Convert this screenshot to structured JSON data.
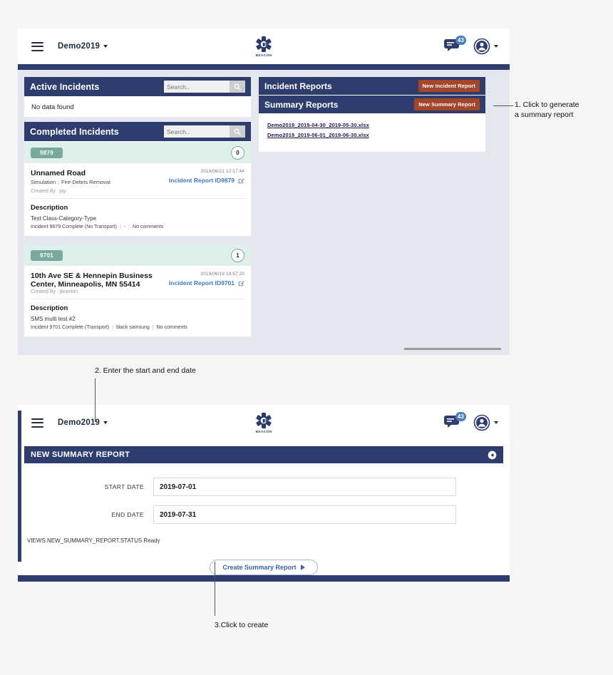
{
  "appbar": {
    "menu_icon": "hamburger-icon",
    "org_name": "Demo2019",
    "brand_word": "BEACON",
    "chat_badge": "43",
    "chat_icon": "chat-bubble-icon",
    "avatar_icon": "user-avatar-icon"
  },
  "active_incidents": {
    "title": "Active Incidents",
    "search_placeholder": "Search..",
    "search_value": "",
    "empty_text": "No data found"
  },
  "completed_incidents": {
    "title": "Completed Incidents",
    "search_placeholder": "Search..",
    "search_value": "",
    "cards": [
      {
        "id_chip": "9879",
        "count": "0",
        "title": "Unnamed Road",
        "sub_left": "Simulation",
        "sub_right": "Fire-Debris Removal",
        "timestamp": "2019/06/21 12:17:44",
        "report_link": "Incident Report ID9879",
        "created_by": "Created By : jay",
        "description_heading": "Description",
        "description_line": "Test Class-Category-Type",
        "meta_status": "Incident 9879 Complete (No Transport)",
        "meta_middle": "-",
        "meta_comments": "No comments"
      },
      {
        "id_chip": "9701",
        "count": "1",
        "title": "10th Ave SE & Hennepin Business Center, Minneapolis, MN 55414",
        "sub_left": "",
        "sub_right": "",
        "timestamp": "2019/06/19 10:57:20",
        "report_link": "Incident Report ID9701",
        "created_by": "Created By : jbranton",
        "description_heading": "Description",
        "description_line": "SMS multi test #2",
        "meta_status": "Incident 9701 Complete (Transport)",
        "meta_middle": "black samsung",
        "meta_comments": "No comments"
      }
    ]
  },
  "incident_reports": {
    "title": "Incident Reports",
    "button_label": "New Incident Report"
  },
  "summary_reports": {
    "title": "Summary Reports",
    "button_label": "New Summary Report",
    "files": [
      "Demo2019_2019-04-30_2019-05-30.xlsx",
      "Demo2019_2019-06-01_2019-06-30.xlsx"
    ]
  },
  "new_summary_report": {
    "title": "NEW SUMMARY REPORT",
    "back_icon": "back-arrow-icon",
    "start_date_label": "START DATE",
    "start_date_value": "2019-07-01",
    "end_date_label": "END DATE",
    "end_date_value": "2019-07-31",
    "status_text": "VIEWS.NEW_SUMMARY_REPORT.STATUS Ready",
    "create_button": "Create Summary Report"
  },
  "annotations": [
    "1. Click to generate\na summary report",
    "2. Enter the start and end date",
    "3.Click to create"
  ],
  "annotation_texts": {
    "one_line1": "1. Click to generate",
    "one_line2": "a summary report",
    "two": "2. Enter the start and end date",
    "three": "3.Click to create"
  },
  "colors": {
    "navy": "#2e3d6e",
    "red": "#a5452a",
    "teal": "#77a99c",
    "link_blue": "#3b78c3",
    "page_bg": "#f5f5f5"
  }
}
